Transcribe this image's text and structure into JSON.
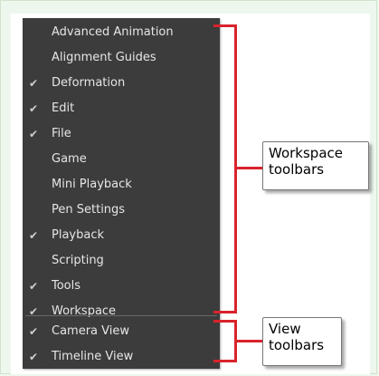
{
  "menu": {
    "workspace_items": [
      {
        "label": "Advanced Animation",
        "checked": false
      },
      {
        "label": "Alignment Guides",
        "checked": false
      },
      {
        "label": "Deformation",
        "checked": true
      },
      {
        "label": "Edit",
        "checked": true
      },
      {
        "label": "File",
        "checked": true
      },
      {
        "label": "Game",
        "checked": false
      },
      {
        "label": "Mini Playback",
        "checked": false
      },
      {
        "label": "Pen Settings",
        "checked": false
      },
      {
        "label": "Playback",
        "checked": true
      },
      {
        "label": "Scripting",
        "checked": false
      },
      {
        "label": "Tools",
        "checked": true
      },
      {
        "label": "Workspace",
        "checked": true
      }
    ],
    "view_items": [
      {
        "label": "Camera View",
        "checked": true
      },
      {
        "label": "Timeline View",
        "checked": true
      }
    ],
    "check_glyph": "✔"
  },
  "callouts": {
    "workspace": {
      "line1": "Workspace",
      "line2": "toolbars"
    },
    "view": {
      "line1": "View",
      "line2": "toolbars"
    }
  },
  "colors": {
    "menu_bg": "#3c3c3c",
    "menu_text": "#e6e6e6",
    "bracket": "#d9232b",
    "page_bg": "#eef7ee"
  }
}
